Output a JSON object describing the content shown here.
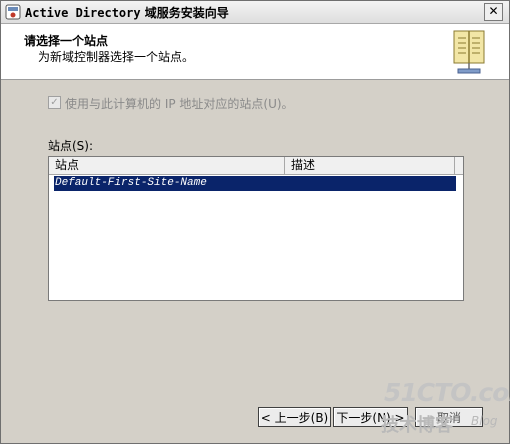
{
  "window": {
    "title_prefix": "Active Directory",
    "title_suffix": " 域服务安装向导",
    "close_symbol": "✕"
  },
  "header": {
    "title": "请选择一个站点",
    "subtitle": "为新域控制器选择一个站点。"
  },
  "checkbox": {
    "label": "使用与此计算机的 IP 地址对应的站点(U)。",
    "checked": true,
    "check_symbol": "✓"
  },
  "sites": {
    "label": "站点(S):",
    "columns": [
      "站点",
      "描述"
    ],
    "rows": [
      {
        "site": "Default-First-Site-Name",
        "description": ""
      }
    ]
  },
  "buttons": {
    "back": "< 上一步(B)",
    "next": "下一步(N) >",
    "cancel": "取消"
  },
  "watermark": {
    "main": "51CTO.com",
    "sub": "技术博客",
    "blog": "Blog"
  }
}
